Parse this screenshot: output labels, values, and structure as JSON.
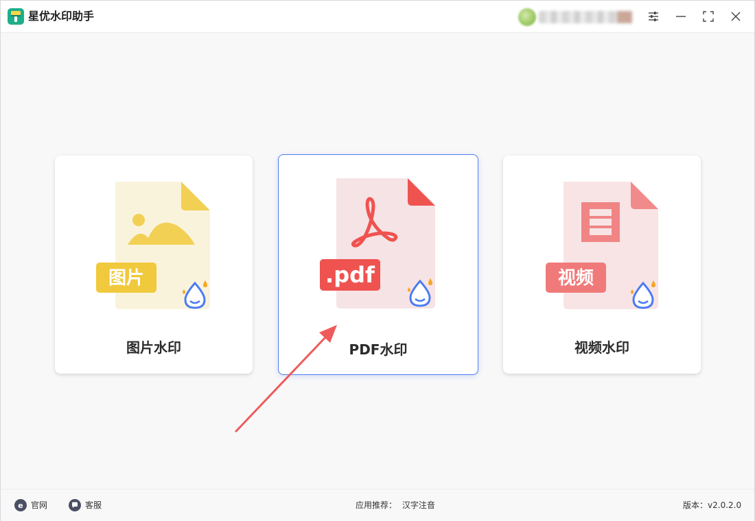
{
  "app": {
    "title": "星优水印助手"
  },
  "cards": [
    {
      "label": "图片水印",
      "badge": "图片",
      "accent": "#f0c93c",
      "paper": "#faf3dc"
    },
    {
      "label": "PDF水印",
      "badge": ".pdf",
      "accent": "#ef5350",
      "paper": "#f6e3e5"
    },
    {
      "label": "视频水印",
      "badge": "视频",
      "accent": "#f07a7a",
      "paper": "#f8e4e5"
    }
  ],
  "statusbar": {
    "official_site": "官网",
    "support": "客服",
    "recommend_label": "应用推荐：",
    "recommend_app": "汉字注音",
    "version_label": "版本：",
    "version": "v2.0.2.0"
  },
  "colors": {
    "selection_border": "#4b7cf0",
    "arrow": "#ef5a5a",
    "drop_icon": "#4b7cf0"
  },
  "icons": {
    "logo": "app-logo-icon",
    "settings": "sliders-icon",
    "minimize": "minimize-icon",
    "maximize": "maximize-icon",
    "close": "close-icon",
    "site": "ie-icon",
    "support": "chat-bubble-icon"
  }
}
